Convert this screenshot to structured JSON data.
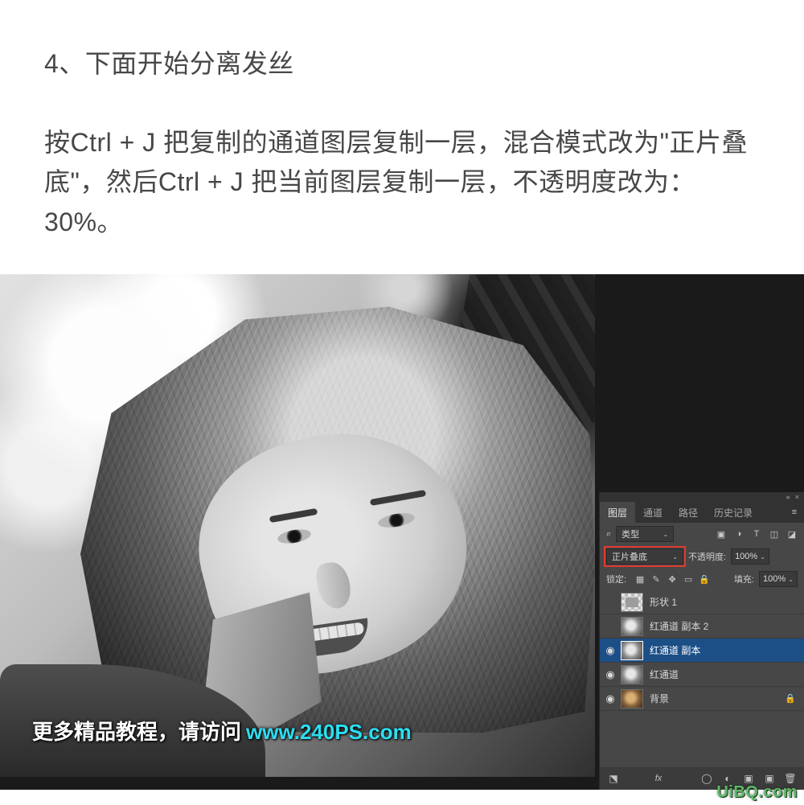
{
  "article": {
    "step_title": "4、下面开始分离发丝",
    "body": "按Ctrl + J 把复制的通道图层复制一层，混合模式改为\"正片叠底\"，然后Ctrl + J 把当前图层复制一层，不透明度改为：30%。"
  },
  "caption": {
    "prefix": "更多精品教程，请访问",
    "link": "www.240PS.com"
  },
  "watermark": "UiBQ.com",
  "panel": {
    "tabs": [
      "图层",
      "通道",
      "路径",
      "历史记录"
    ],
    "active_tab_index": 0,
    "filter": {
      "kind_label": "类型",
      "search_icon": "search-icon"
    },
    "blend": {
      "mode": "正片叠底",
      "opacity_label": "不透明度:",
      "opacity_value": "100%"
    },
    "lock": {
      "label": "锁定:",
      "fill_label": "填充:",
      "fill_value": "100%"
    },
    "layers": [
      {
        "visible": false,
        "thumb": "shape",
        "name": "形状 1",
        "selected": false,
        "locked": false
      },
      {
        "visible": false,
        "thumb": "gray",
        "name": "红通道 副本 2",
        "selected": false,
        "locked": false
      },
      {
        "visible": true,
        "thumb": "gray",
        "name": "红通道 副本",
        "selected": true,
        "locked": false
      },
      {
        "visible": true,
        "thumb": "gray",
        "name": "红通道",
        "selected": false,
        "locked": false
      },
      {
        "visible": true,
        "thumb": "bg",
        "name": "背景",
        "selected": false,
        "locked": true
      }
    ]
  },
  "icons": {
    "eye": "◉",
    "menu": "≡",
    "caret": "⌄",
    "search": "⌕",
    "image": "▣",
    "adjust": "◑",
    "text": "T",
    "path": "◫",
    "smart": "◪",
    "lock_pixels": "▦",
    "lock_position": "✥",
    "lock_brush": "✎",
    "lock_artboard": "▭",
    "lock_all": "🔒",
    "link": "⬔",
    "fx": "fx",
    "mask": "◯",
    "adjust_layer": "◐",
    "folder": "▣",
    "new": "▣",
    "trash": "🗑",
    "collapse": "«",
    "close": "×"
  }
}
